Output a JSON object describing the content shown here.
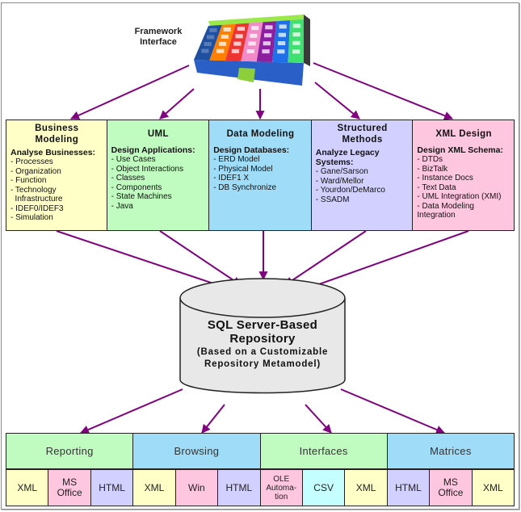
{
  "framework": {
    "label_line1": "Framework",
    "label_line2": "Interface",
    "panel_colors": [
      "#1f4fa0",
      "#ff7f00",
      "#ee3333",
      "#f28ac8",
      "#8b1fa0",
      "#1e6fe8",
      "#3fe070"
    ]
  },
  "colors": {
    "arrow": "#800080",
    "border": "#222222",
    "yellow": "#ffffc8",
    "green": "#c0fbc0",
    "blue": "#9fdcf8",
    "lavender": "#d2d0ff",
    "pink": "#ffc6e0",
    "cyan": "#c6ffff",
    "repository_fill": "#e8e8e8"
  },
  "tools": [
    {
      "title": "Business Modeling",
      "title_lines": [
        "Business",
        "Modeling"
      ],
      "subtitle": "Analyse Businesses:",
      "items": [
        "- Processes",
        "- Organization",
        "- Function",
        "- Technology",
        "  Infrastructure",
        "- IDEF0/IDEF3",
        "- Simulation"
      ],
      "color": "#ffffc8"
    },
    {
      "title": "UML",
      "title_lines": [
        "UML"
      ],
      "subtitle": "Design Applications:",
      "items": [
        "- Use Cases",
        "- Object Interactions",
        "- Classes",
        "- Components",
        "- State Machines",
        "- Java"
      ],
      "color": "#c0fbc0"
    },
    {
      "title": "Data Modeling",
      "title_lines": [
        "Data Modeling"
      ],
      "subtitle": "Design Databases:",
      "items": [
        "- ERD Model",
        "- Physical Model",
        "- IDEF1 X",
        "- DB Synchronize"
      ],
      "color": "#9fdcf8"
    },
    {
      "title": "Structured Methods",
      "title_lines": [
        "Structured",
        "Methods"
      ],
      "subtitle": "Analyze Legacy Systems:",
      "items": [
        "- Gane/Sarson",
        "- Ward/Mellor",
        "- Yourdon/DeMarco",
        "- SSADM"
      ],
      "color": "#d2d0ff"
    },
    {
      "title": "XML Design",
      "title_lines": [
        "XML Design"
      ],
      "subtitle": "Design XML Schema:",
      "items": [
        "- DTDs",
        "- BizTalk",
        "- Instance Docs",
        "- Text Data",
        "- UML Integration (XMI)",
        "- Data Modeling",
        "Integration"
      ],
      "color": "#ffc6e0"
    }
  ],
  "repository": {
    "title_line1": "SQL Server-Based",
    "title_line2": "Repository",
    "subtitle_line1": "(Based on a Customizable",
    "subtitle_line2": "Repository Metamodel)"
  },
  "outputs": [
    {
      "label": "Reporting",
      "color": "#c0fbc0",
      "cells": [
        {
          "label": "XML",
          "color": "#ffffc8"
        },
        {
          "label": "MS\nOffice",
          "color": "#ffc6e0"
        },
        {
          "label": "HTML",
          "color": "#d2d0ff"
        }
      ]
    },
    {
      "label": "Browsing",
      "color": "#9fdcf8",
      "cells": [
        {
          "label": "XML",
          "color": "#ffffc8"
        },
        {
          "label": "Win",
          "color": "#ffc6e0"
        },
        {
          "label": "HTML",
          "color": "#d2d0ff"
        }
      ]
    },
    {
      "label": "Interfaces",
      "color": "#c0fbc0",
      "cells": [
        {
          "label": "OLE\nAutoma-\ntion",
          "color": "#ffc6e0",
          "small": true
        },
        {
          "label": "CSV",
          "color": "#c6ffff"
        },
        {
          "label": "XML",
          "color": "#ffffc8"
        }
      ]
    },
    {
      "label": "Matrices",
      "color": "#9fdcf8",
      "cells": [
        {
          "label": "HTML",
          "color": "#d2d0ff"
        },
        {
          "label": "MS\nOffice",
          "color": "#ffc6e0"
        },
        {
          "label": "XML",
          "color": "#ffffc8"
        }
      ]
    }
  ]
}
